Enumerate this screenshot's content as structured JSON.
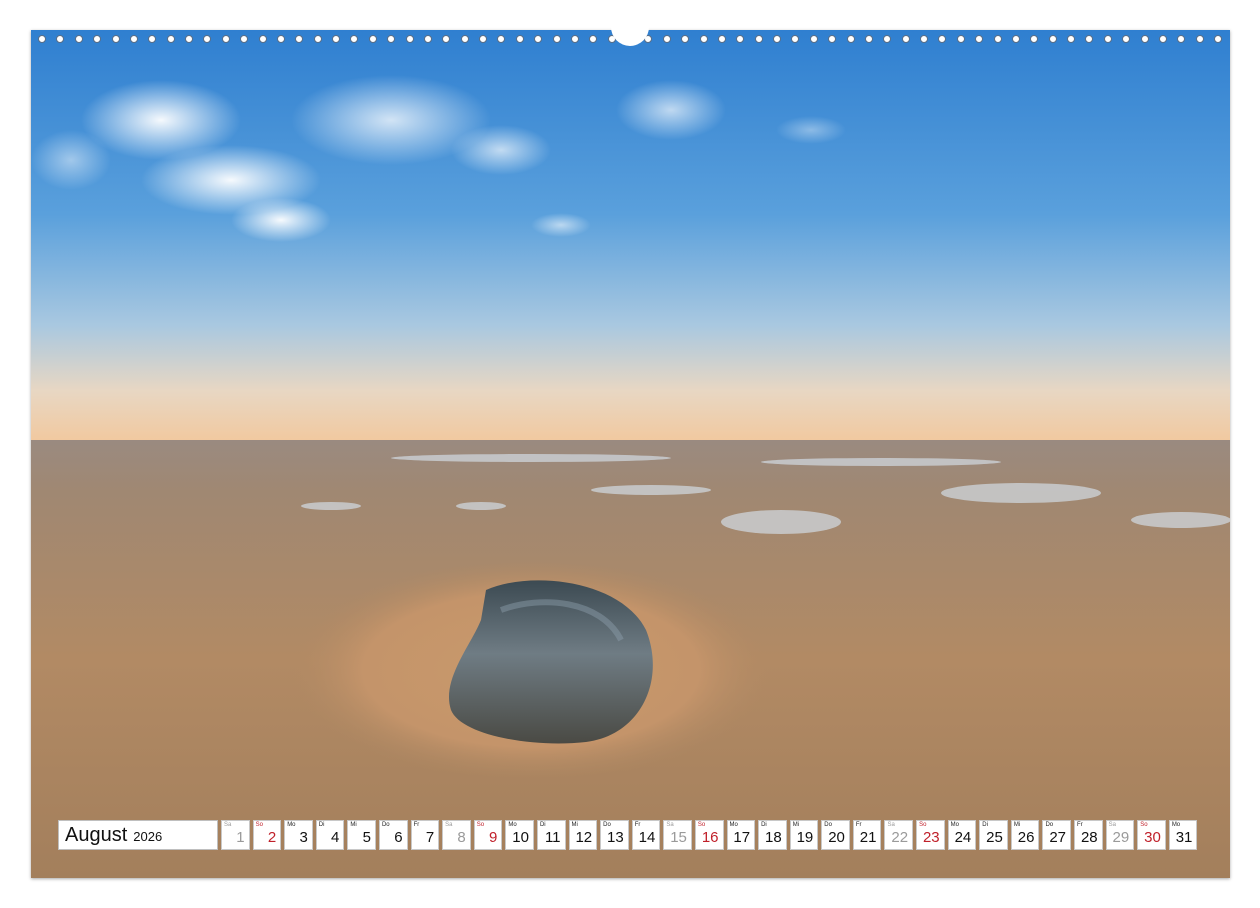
{
  "calendar": {
    "month": "August",
    "year": "2026",
    "days": [
      {
        "wd": "Sa",
        "d": "1",
        "type": "sat"
      },
      {
        "wd": "So",
        "d": "2",
        "type": "sun"
      },
      {
        "wd": "Mo",
        "d": "3",
        "type": "wk"
      },
      {
        "wd": "Di",
        "d": "4",
        "type": "wk"
      },
      {
        "wd": "Mi",
        "d": "5",
        "type": "wk"
      },
      {
        "wd": "Do",
        "d": "6",
        "type": "wk"
      },
      {
        "wd": "Fr",
        "d": "7",
        "type": "wk"
      },
      {
        "wd": "Sa",
        "d": "8",
        "type": "sat"
      },
      {
        "wd": "So",
        "d": "9",
        "type": "sun"
      },
      {
        "wd": "Mo",
        "d": "10",
        "type": "wk"
      },
      {
        "wd": "Di",
        "d": "11",
        "type": "wk"
      },
      {
        "wd": "Mi",
        "d": "12",
        "type": "wk"
      },
      {
        "wd": "Do",
        "d": "13",
        "type": "wk"
      },
      {
        "wd": "Fr",
        "d": "14",
        "type": "wk"
      },
      {
        "wd": "Sa",
        "d": "15",
        "type": "sat"
      },
      {
        "wd": "So",
        "d": "16",
        "type": "sun"
      },
      {
        "wd": "Mo",
        "d": "17",
        "type": "wk"
      },
      {
        "wd": "Di",
        "d": "18",
        "type": "wk"
      },
      {
        "wd": "Mi",
        "d": "19",
        "type": "wk"
      },
      {
        "wd": "Do",
        "d": "20",
        "type": "wk"
      },
      {
        "wd": "Fr",
        "d": "21",
        "type": "wk"
      },
      {
        "wd": "Sa",
        "d": "22",
        "type": "sat"
      },
      {
        "wd": "So",
        "d": "23",
        "type": "sun"
      },
      {
        "wd": "Mo",
        "d": "24",
        "type": "wk"
      },
      {
        "wd": "Di",
        "d": "25",
        "type": "wk"
      },
      {
        "wd": "Mi",
        "d": "26",
        "type": "wk"
      },
      {
        "wd": "Do",
        "d": "27",
        "type": "wk"
      },
      {
        "wd": "Fr",
        "d": "28",
        "type": "wk"
      },
      {
        "wd": "Sa",
        "d": "29",
        "type": "sat"
      },
      {
        "wd": "So",
        "d": "30",
        "type": "sun"
      },
      {
        "wd": "Mo",
        "d": "31",
        "type": "wk"
      }
    ]
  },
  "colors": {
    "sunday": "#c0202a",
    "saturday": "#9a9a9a",
    "binding_ring": "#5a6e86"
  }
}
